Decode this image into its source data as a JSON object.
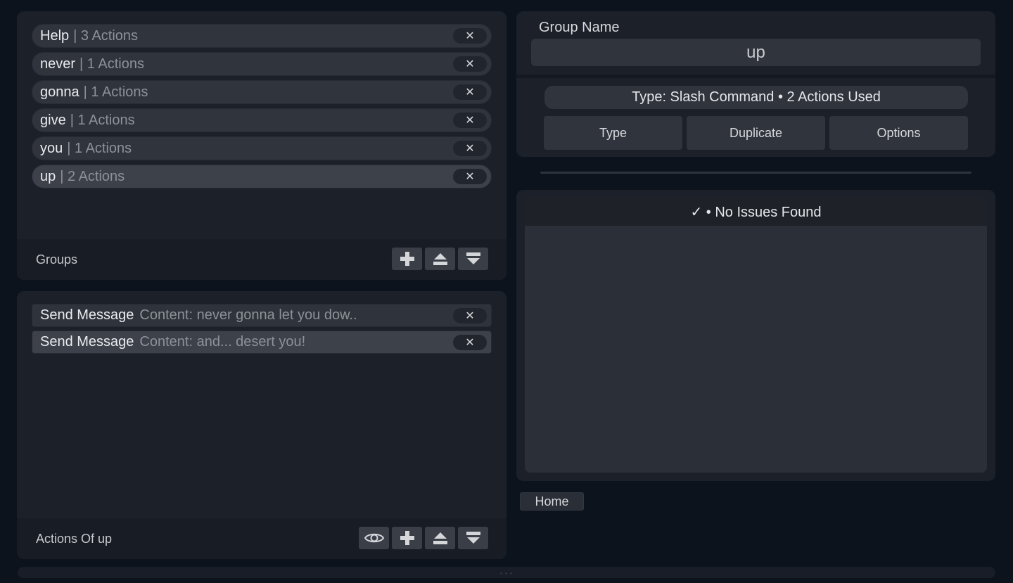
{
  "groups": {
    "footer_label": "Groups",
    "items": [
      {
        "name": "Help",
        "meta": "| 3 Actions"
      },
      {
        "name": "never",
        "meta": "| 1 Actions"
      },
      {
        "name": "gonna",
        "meta": "| 1 Actions"
      },
      {
        "name": "give",
        "meta": "| 1 Actions"
      },
      {
        "name": "you",
        "meta": "| 1 Actions"
      },
      {
        "name": "up",
        "meta": "| 2 Actions"
      }
    ],
    "selected_index": 5
  },
  "actions": {
    "footer_label": "Actions Of up",
    "items": [
      {
        "name": "Send Message",
        "meta": "Content: never gonna let you dow.."
      },
      {
        "name": "Send Message",
        "meta": "Content: and... desert you!"
      }
    ],
    "selected_index": 1
  },
  "group_editor": {
    "label": "Group Name",
    "value": "up",
    "type_info": "Type: Slash Command • 2 Actions Used",
    "buttons": [
      "Type",
      "Duplicate",
      "Options"
    ]
  },
  "issues": {
    "header": "✓ • No Issues Found"
  },
  "nav": {
    "home_label": "Home"
  },
  "icons": {
    "remove": "close-icon",
    "add": "plus-icon",
    "move_up": "move-up-icon",
    "move_down": "move-down-icon",
    "preview": "eye-icon"
  },
  "colors": {
    "background": "#0d131d",
    "panel": "#1c2029",
    "pill": "#30343d",
    "pill_selected": "#3c414a"
  }
}
